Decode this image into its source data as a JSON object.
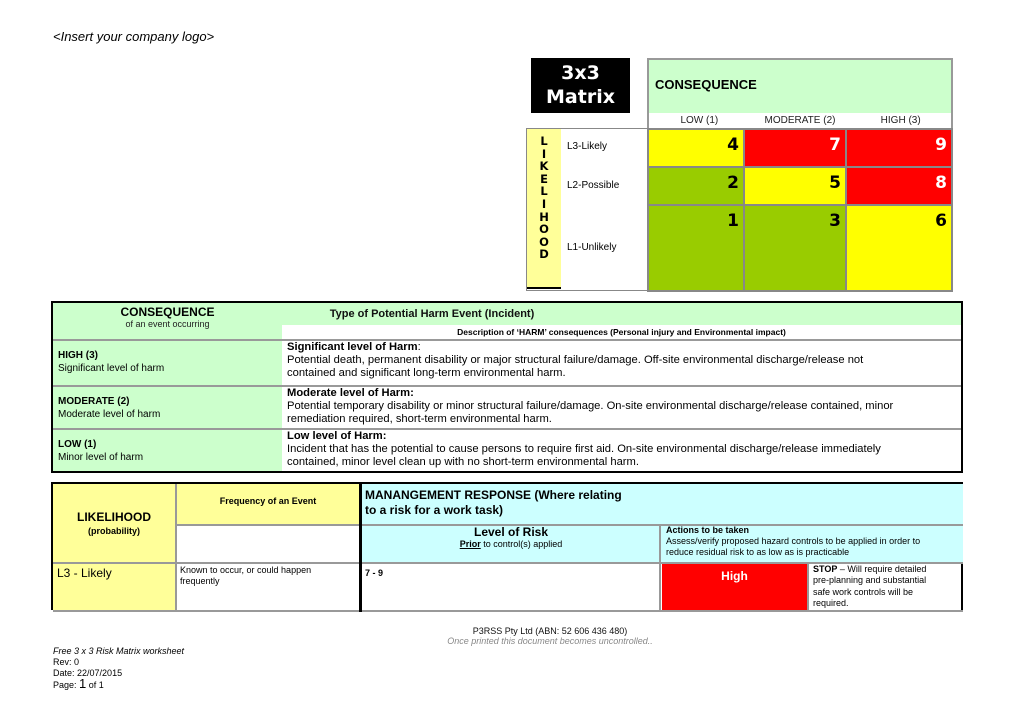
{
  "header": {
    "logo_placeholder": "<Insert your company logo>"
  },
  "matrix": {
    "title_line1": "3x3",
    "title_line2": "Matrix",
    "consequence_label": "CONSEQUENCE",
    "consequence_columns": [
      "LOW (1)",
      "MODERATE (2)",
      "HIGH (3)"
    ],
    "likelihood_vertical": [
      "L",
      "I",
      "K",
      "E",
      "L",
      "I",
      "H",
      "O",
      "O",
      "D"
    ],
    "likelihood_rows": [
      "L3-Likely",
      "L2-Possible",
      "L1-Unlikely"
    ],
    "cells": [
      [
        {
          "value": "4",
          "color": "#ffff00",
          "text": "#000000"
        },
        {
          "value": "7",
          "color": "#ff0000",
          "text": "#ffffff"
        },
        {
          "value": "9",
          "color": "#ff0000",
          "text": "#ffffff"
        }
      ],
      [
        {
          "value": "2",
          "color": "#99cc00",
          "text": "#000000"
        },
        {
          "value": "5",
          "color": "#ffff00",
          "text": "#000000"
        },
        {
          "value": "8",
          "color": "#ff0000",
          "text": "#ffffff"
        }
      ],
      [
        {
          "value": "1",
          "color": "#99cc00",
          "text": "#000000"
        },
        {
          "value": "3",
          "color": "#99cc00",
          "text": "#000000"
        },
        {
          "value": "6",
          "color": "#ffff00",
          "text": "#000000"
        }
      ]
    ]
  },
  "consequence_table": {
    "title": "CONSEQUENCE",
    "subtitle": "of an event occurring",
    "right_title": "Type of Potential Harm Event (Incident)",
    "right_subtitle": "Description of ‘HARM’ consequences (Personal injury and Environmental impact)",
    "rows": [
      {
        "level": "HIGH (3)",
        "level_desc": "Significant level of harm",
        "heading": "Significant level of Harm",
        "heading_suffix": ":",
        "line1": "Potential death, permanent disability or major structural failure/damage. Off-site environmental discharge/release not",
        "line2": "contained and significant long-term environmental harm."
      },
      {
        "level": "MODERATE (2)",
        "level_desc": "Moderate level of harm",
        "heading": "Moderate level of Harm:",
        "heading_suffix": "",
        "line1": "Potential temporary disability or minor structural failure/damage. On-site environmental discharge/release contained, minor",
        "line2": "remediation required, short-term environmental harm."
      },
      {
        "level": "LOW (1)",
        "level_desc": "Minor level of harm",
        "heading": "Low level of Harm:",
        "heading_suffix": "",
        "line1": "Incident that has the potential to cause persons to require first aid. On-site environmental discharge/release immediately",
        "line2": "contained, minor level clean up with no short-term environmental harm."
      }
    ]
  },
  "likelihood_table": {
    "likelihood_title": "LIKELIHOOD",
    "likelihood_sub": "(probability)",
    "frequency_title": "Frequency of an Event",
    "management_title_1": "MANANGEMENT RESPONSE (Where relating",
    "management_title_2": "to a risk for a work task)",
    "level_title": "Level of Risk",
    "level_sub_prefix": "Prior",
    "level_sub_rest": " to control(s) applied",
    "actions_title": "Actions to be taken",
    "actions_desc_1": "Assess/verify proposed hazard controls to be applied in order to",
    "actions_desc_2": "reduce residual risk to as low as is practicable",
    "rows": [
      {
        "likelihood": "L3 - Likely",
        "frequency_1": "Known to occur, or could happen",
        "frequency_2": "frequently",
        "range": "7 - 9",
        "risk_level": "High",
        "risk_color": "#ff0000",
        "action_bold": "STOP",
        "action_1": " – Will require detailed",
        "action_2": "pre-planning and substantial",
        "action_3": "safe work controls will be",
        "action_4": "required."
      }
    ]
  },
  "footer": {
    "company": "P3RSS Pty Ltd  (ABN: 52 606 436 480)",
    "uncontrolled": "Once printed this document becomes uncontrolled..",
    "doc_title": "Free 3 x 3 Risk Matrix worksheet",
    "rev_label": "Rev:",
    "rev": "0",
    "date_label": "Date:",
    "date": "22/07/2015",
    "page_label": "Page:",
    "page": "1",
    "page_of": "of 1"
  }
}
